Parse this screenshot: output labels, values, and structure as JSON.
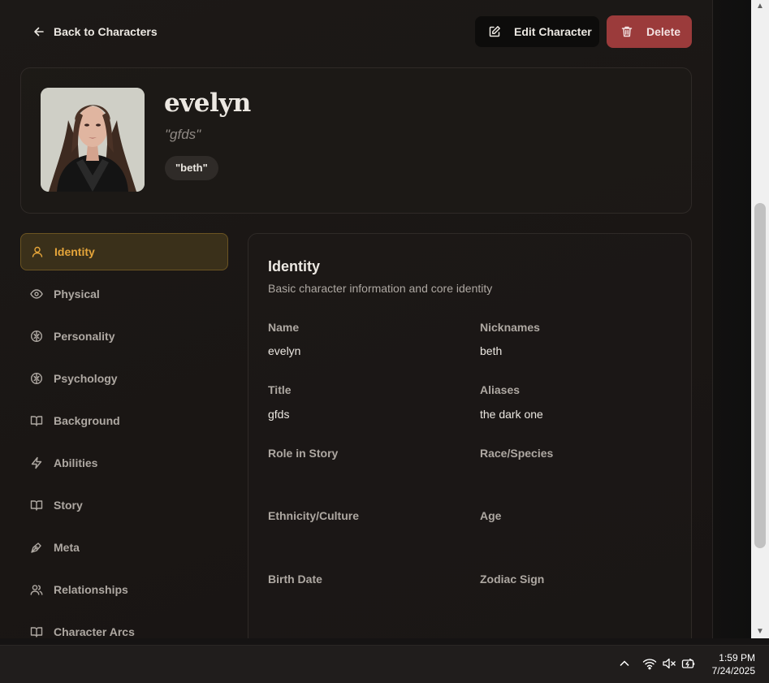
{
  "header": {
    "back_label": "Back to Characters",
    "edit_label": "Edit Character",
    "delete_label": "Delete"
  },
  "character": {
    "name": "evelyn",
    "title": "\"gfds\"",
    "nickname_badge": "\"beth\""
  },
  "sidebar": {
    "items": [
      {
        "label": "Identity",
        "icon": "user-icon",
        "active": true
      },
      {
        "label": "Physical",
        "icon": "eye-icon",
        "active": false
      },
      {
        "label": "Personality",
        "icon": "brain-icon",
        "active": false
      },
      {
        "label": "Psychology",
        "icon": "brain-icon",
        "active": false
      },
      {
        "label": "Background",
        "icon": "book-icon",
        "active": false
      },
      {
        "label": "Abilities",
        "icon": "bolt-icon",
        "active": false
      },
      {
        "label": "Story",
        "icon": "book-icon",
        "active": false
      },
      {
        "label": "Meta",
        "icon": "pen-icon",
        "active": false
      },
      {
        "label": "Relationships",
        "icon": "users-icon",
        "active": false
      },
      {
        "label": "Character Arcs",
        "icon": "book-icon",
        "active": false
      }
    ]
  },
  "panel": {
    "title": "Identity",
    "description": "Basic character information and core identity",
    "fields": [
      {
        "label": "Name",
        "value": "evelyn"
      },
      {
        "label": "Nicknames",
        "value": "beth"
      },
      {
        "label": "Title",
        "value": "gfds"
      },
      {
        "label": "Aliases",
        "value": "the dark one"
      },
      {
        "label": "Role in Story",
        "value": ""
      },
      {
        "label": "Race/Species",
        "value": ""
      },
      {
        "label": "Ethnicity/Culture",
        "value": ""
      },
      {
        "label": "Age",
        "value": ""
      },
      {
        "label": "Birth Date",
        "value": ""
      },
      {
        "label": "Zodiac Sign",
        "value": ""
      }
    ]
  },
  "taskbar": {
    "time": "1:59 PM",
    "date": "7/24/2025"
  },
  "colors": {
    "accent": "#e5a53a",
    "danger": "#9b3b3b",
    "background": "#1c1917"
  }
}
